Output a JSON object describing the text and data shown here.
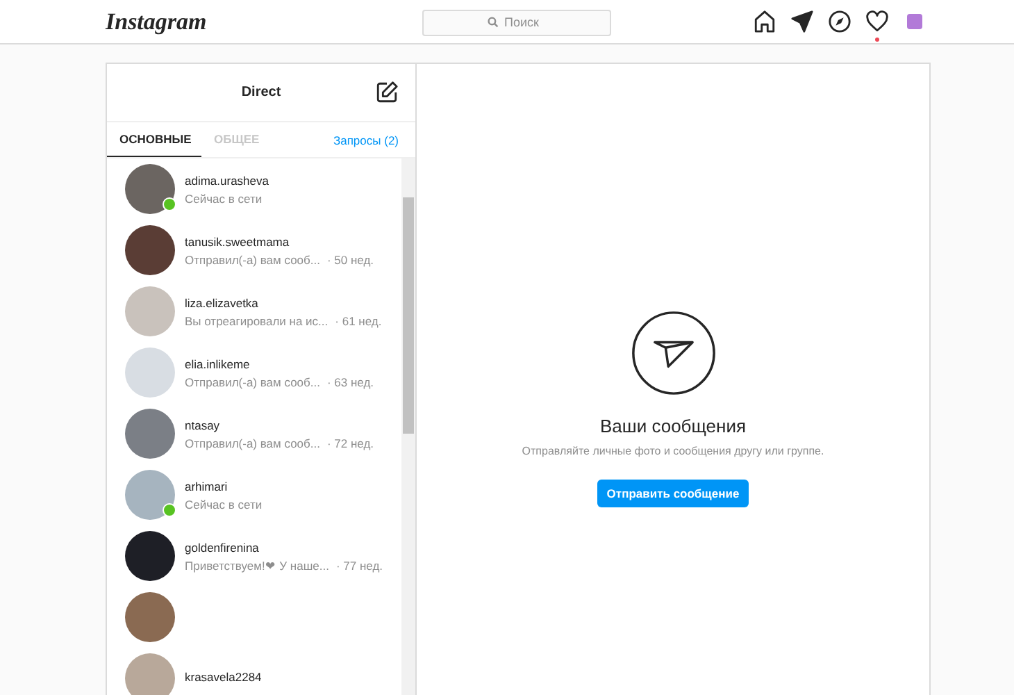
{
  "header": {
    "logo": "Instagram",
    "search": {
      "placeholder": "Поиск"
    },
    "nav": [
      {
        "kind": "home",
        "badge": false
      },
      {
        "kind": "send",
        "badge": false
      },
      {
        "kind": "compass",
        "badge": false
      },
      {
        "kind": "heart",
        "badge": true
      },
      {
        "kind": "profile",
        "badge": false
      }
    ]
  },
  "sidebar": {
    "title": "Direct",
    "tabs": [
      {
        "label": "ОСНОВНЫЕ",
        "selected": true
      },
      {
        "label": "ОБЩЕЕ",
        "selected": false
      }
    ],
    "requests": "Запросы (2)",
    "conversations": [
      {
        "name": "adima.urasheva",
        "preview": "Сейчас в сети",
        "online": true
      },
      {
        "name": "tanusik.sweetmama",
        "preview": "Отправил(-а) вам сооб...",
        "time": "· 50 нед.",
        "online": false
      },
      {
        "name": "liza.elizavetka",
        "preview": "Вы отреагировали на ис...",
        "time": "· 61 нед.",
        "online": false
      },
      {
        "name": "elia.inlikeme",
        "preview": "Отправил(-а) вам сооб...",
        "time": "· 63 нед.",
        "online": false
      },
      {
        "name": "ntasay",
        "preview": "Отправил(-а) вам сооб...",
        "time": "· 72 нед.",
        "online": false
      },
      {
        "name": "arhimari",
        "preview": "Сейчас в сети",
        "online": true
      },
      {
        "name": "goldenfirenina",
        "preview": "Приветствуем!❤ У наше...",
        "time": "· 77 нед.",
        "online": false
      },
      {
        "online": false
      },
      {
        "name": "krasavela2284",
        "online": false
      }
    ]
  },
  "main": {
    "title": "Ваши сообщения",
    "subtitle": "Отправляйте личные фото и сообщения другу или группе.",
    "button": "Отправить сообщение"
  }
}
